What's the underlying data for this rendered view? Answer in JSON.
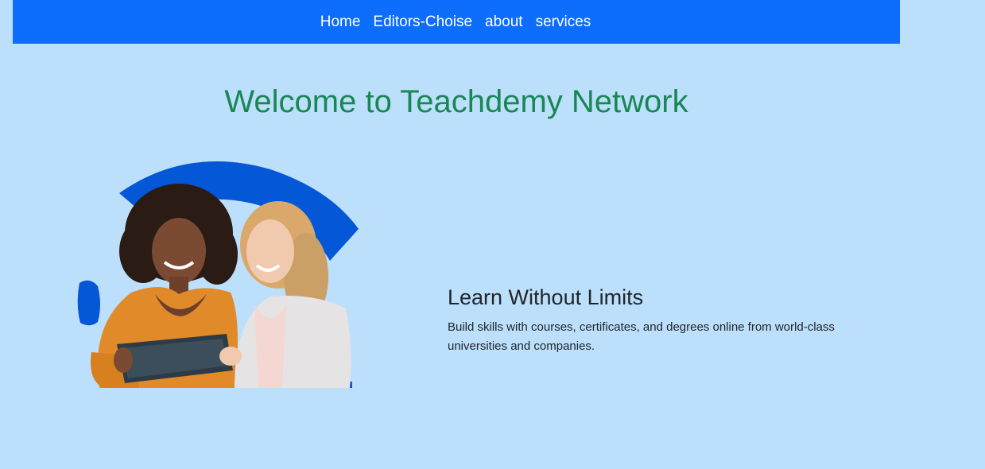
{
  "navbar": {
    "items": [
      {
        "label": "Home"
      },
      {
        "label": "Editors-Choise"
      },
      {
        "label": "about"
      },
      {
        "label": "services"
      }
    ]
  },
  "page": {
    "title": "Welcome to Teachdemy Network"
  },
  "hero": {
    "heading": "Learn Without Limits",
    "description": "Build skills with courses, certificates, and degrees online from world-class universities and companies."
  },
  "colors": {
    "navbar_bg": "#0d6efd",
    "page_bg": "#bcdffc",
    "title": "#198754",
    "accent_shape": "#0457d6"
  }
}
